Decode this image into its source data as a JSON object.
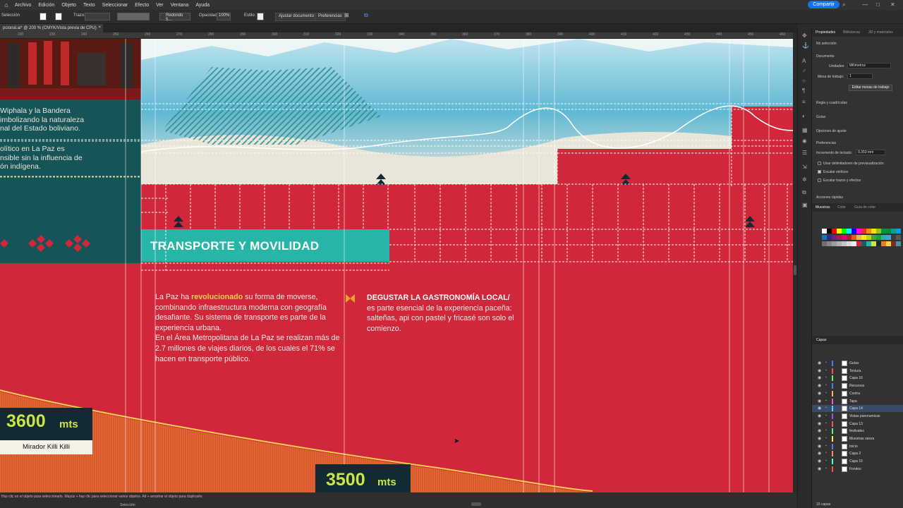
{
  "menubar": {
    "items": [
      "Archivo",
      "Edición",
      "Objeto",
      "Texto",
      "Seleccionar",
      "Efecto",
      "Ver",
      "Ventana",
      "Ayuda"
    ],
    "share": "Compartir"
  },
  "controlbar": {
    "selection": "Selección",
    "stroke": "Trazo:",
    "brush": "Redondo 5...",
    "opacity_label": "Opacidad:",
    "opacity_value": "100%",
    "style_label": "Estilo:",
    "adjust_doc": "Ajustar documento",
    "prefs": "Preferencias"
  },
  "doc_tab": {
    "title": "pcional.ai* @ 200 % (CMYK/Vista previa de CPU)",
    "close": "×"
  },
  "ruler": {
    "ticks": [
      "220",
      "230",
      "240",
      "250",
      "260",
      "270",
      "280",
      "290",
      "300",
      "310",
      "320",
      "330",
      "340",
      "350",
      "360",
      "370",
      "380",
      "390",
      "400",
      "410",
      "420",
      "430",
      "440",
      "450",
      "460",
      "470"
    ]
  },
  "artboard": {
    "side_text_1": "Wiphala y la Bandera\nimbolizando la naturaleza\nnal del Estado boliviano.",
    "side_text_2": "olítico en La Paz es\nnsible sin la influencia de\nón indígena.",
    "section_title": "TRANSPORTE Y MOVILIDAD",
    "body_pre": "La Paz ha ",
    "body_highlight": "revolucionado",
    "body_post": " su forma de moverse, combinando infraestructura moderna con geografía desafiante. Su sistema de transporte es parte de la experiencia urbana.\nEn el Área Metropolitana de La Paz se realizan más de 2.7 millones de viajes diarios, de los cuales el 71% se hacen en transporte público.",
    "food_title": "DEGUSTAR LA GASTRONOMÍA LOCAL/",
    "food_body": " es parte esencial de la experiencia paceña: salteñas, api con pastel y fricasé son solo el comienzo.",
    "alt1_value": "3600",
    "alt1_unit": "mts",
    "alt1_label": "Mirador Killi Killi",
    "alt2_value": "3500",
    "alt2_unit": "mts"
  },
  "statusbar": {
    "hint": "Haz clic en el objeto para seleccionarlo. Mayús + haz clic para seleccionar varios objetos. Alt + arrastrar el objeto para duplicarlo.",
    "tool": "Selección"
  },
  "properties": {
    "tabs": [
      "Propiedades",
      "Bibliotecas",
      "3D y materiales"
    ],
    "no_selection": "No selección",
    "document": "Documento",
    "units_label": "Unidades:",
    "units_value": "Milímetros",
    "artboard_label": "Mesa de trabajo:",
    "artboard_value": "1",
    "edit_artboards": "Editar mesas de trabajo",
    "rulers_grids": "Regla y cuadrículas",
    "guides": "Guías",
    "snap_options": "Opciones de ajuste",
    "preferences": "Preferencias",
    "keyboard_inc_label": "Incremento de teclado:",
    "keyboard_inc_value": "0,353 mm",
    "use_preview_bounds": "Usar delimitadores de previsualización",
    "scale_corners": "Escalar vértices",
    "scale_strokes": "Escalar trazos y efectos",
    "quick_actions": "Acciones rápidas"
  },
  "swatches": {
    "tabs": [
      "Muestras",
      "Color",
      "Guía de color"
    ],
    "colors": [
      "#ffffff",
      "#000000",
      "#ff0000",
      "#ffff00",
      "#00ff00",
      "#00ffff",
      "#0000ff",
      "#ff00ff",
      "#e6332a",
      "#f39200",
      "#ffde00",
      "#95c11f",
      "#009640",
      "#008d36",
      "#00a19a",
      "#009ee3",
      "#1d71b8",
      "#2d2e83",
      "#662483",
      "#a3195b",
      "#e6007e",
      "#be1622",
      "#ea5b0c",
      "#f9b233",
      "#fcea10",
      "#c6d300",
      "#3aaa35",
      "#13a538",
      "#1bb7b0",
      "#36a9e1",
      "#3c3c3b",
      "#575756",
      "#706f6f",
      "#878787",
      "#9d9d9c",
      "#b2b2b2",
      "#c6c6c6",
      "#dadada",
      "#ededed",
      "#d0283a",
      "#1a5e60",
      "#27b5a8",
      "#c9e645",
      "#142a32",
      "#e47c2b",
      "#f1d04b",
      "#7b2d26",
      "#4e8fae"
    ]
  },
  "layers": {
    "tab": "Capas",
    "items": [
      {
        "name": "Guías",
        "color": "#4f7cff"
      },
      {
        "name": "Textura",
        "color": "#ff4f4f"
      },
      {
        "name": "Capa 16",
        "color": "#4fff6a"
      },
      {
        "name": "Recursos",
        "color": "#4f7cff"
      },
      {
        "name": "Contra",
        "color": "#ffb84f"
      },
      {
        "name": "Tapa",
        "color": "#ff4fe0"
      },
      {
        "name": "Capa 14",
        "color": "#4fd9ff"
      },
      {
        "name": "Vistas panoramicas",
        "color": "#9a4fff"
      },
      {
        "name": "Capa 13",
        "color": "#ff4f4f"
      },
      {
        "name": "festivales",
        "color": "#4fff6a"
      },
      {
        "name": "Muestras raices",
        "color": "#ffee4f"
      },
      {
        "name": "Inicio",
        "color": "#4f7cff"
      },
      {
        "name": "Capa 2",
        "color": "#ff8f4f"
      },
      {
        "name": "Capa 15",
        "color": "#4fffcc"
      },
      {
        "name": "Fondos",
        "color": "#ff4f4f"
      }
    ],
    "count": "15 capas"
  }
}
